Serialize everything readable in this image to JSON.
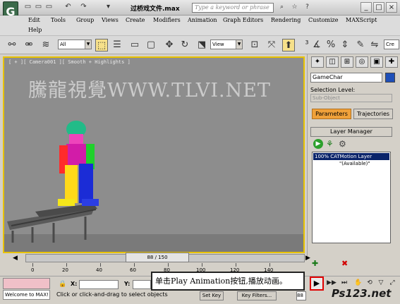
{
  "titlebar": {
    "app_logo": "G",
    "file_title": "过桥戏文件.max",
    "search_placeholder": "Type a keyword or phrase",
    "quick_access": [
      "▭",
      "▭",
      "▭",
      "↶",
      "↷",
      "▾"
    ]
  },
  "menu": {
    "items": [
      "Edit",
      "Tools",
      "Group",
      "Views",
      "Create",
      "Modifiers",
      "Animation",
      "Graph Editors",
      "Rendering",
      "Customize",
      "MAXScript",
      "Help"
    ]
  },
  "toolbar": {
    "selection_filter": "All",
    "ref_coord": "View",
    "search_field": "Cre"
  },
  "viewport": {
    "label": "[ + ][ Camera001 ][ Smooth + Highlights ]",
    "watermark": "騰龍視覺WWW.TLVI.NET"
  },
  "command_panel": {
    "object_name": "GameChar",
    "object_color": "#1e4fb8",
    "selection_level_label": "Selection Level:",
    "sub_object": "Sub-Object",
    "params_tab": "Parameters",
    "trajectories_tab": "Trajectories",
    "rollout_title": "Layer Manager",
    "layer_name": "100% CATMotion Layer",
    "layer_status": "\"(Available)\""
  },
  "timeline": {
    "frame_indicator": "88 / 150",
    "ticks": [
      "0",
      "20",
      "40",
      "60",
      "80",
      "100",
      "120",
      "140"
    ]
  },
  "status": {
    "maxscript_text": "Welcome to MAX!",
    "prompt": "Click or click-and-drag to select objects",
    "x_label": "X:",
    "y_label": "Y:",
    "set_key": "Set Key",
    "key_filters": "Key Filters...",
    "frame_field": "88"
  },
  "callout": {
    "text": "单击Play Animation按钮,播放动画。"
  },
  "watermark_logo": "Ps123.net"
}
